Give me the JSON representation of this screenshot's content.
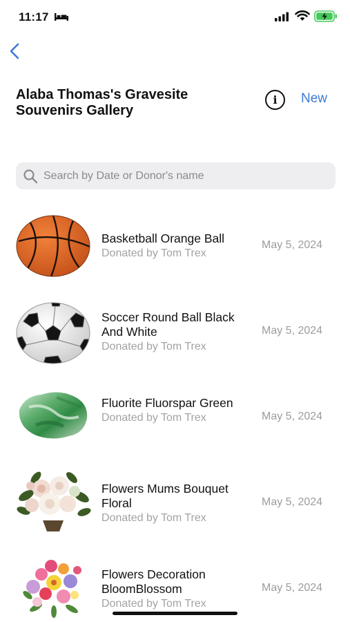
{
  "status_bar": {
    "time": "11:17",
    "icons": [
      "bed-icon",
      "signal-icon",
      "wifi-icon",
      "battery-charging-icon"
    ],
    "battery_color": "#44c95a"
  },
  "nav": {
    "back_icon": "chevron-left-icon",
    "title": "Alaba Thomas's Gravesite Souvenirs Gallery",
    "info_icon": "info-circle-icon",
    "info_glyph": "i",
    "new_label": "New",
    "accent_color": "#3b7ad6"
  },
  "search": {
    "placeholder": "Search by Date or Donor's name",
    "value": "",
    "icon": "search-icon"
  },
  "items": [
    {
      "name": "Basketball Orange Ball",
      "donor": "Donated by Tom Trex",
      "date": "May 5, 2024",
      "image": "basketball-image"
    },
    {
      "name": "Soccer Round Ball Black And White",
      "donor": "Donated by Tom Trex",
      "date": "May 5, 2024",
      "image": "soccer-ball-image"
    },
    {
      "name": "Fluorite Fluorspar Green",
      "donor": "Donated by Tom Trex",
      "date": "May 5, 2024",
      "image": "fluorite-stone-image"
    },
    {
      "name": "Flowers Mums Bouquet Floral",
      "donor": "Donated by Tom Trex",
      "date": "May 5, 2024",
      "image": "mums-bouquet-image"
    },
    {
      "name": "Flowers Decoration BloomBlossom",
      "donor": "Donated by Tom Trex",
      "date": "May 5, 2024",
      "image": "flower-decoration-image"
    }
  ]
}
